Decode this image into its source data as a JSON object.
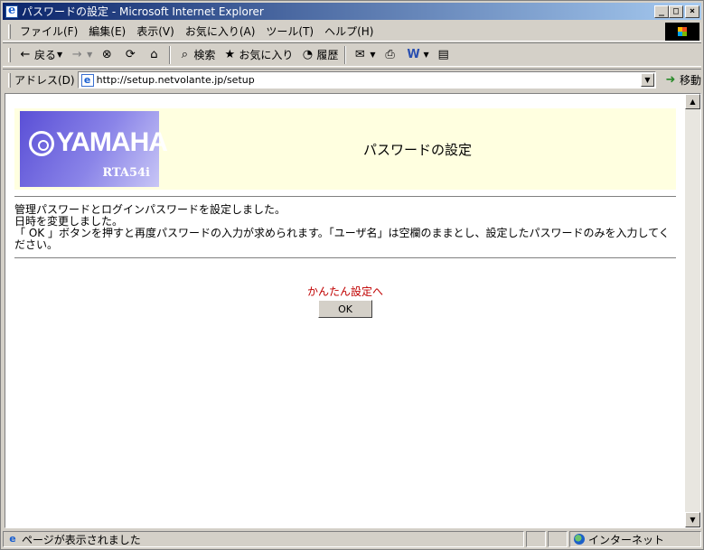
{
  "window": {
    "title": "パスワードの設定 - Microsoft Internet Explorer",
    "minimize": "_",
    "maximize": "□",
    "close": "×"
  },
  "menu": {
    "items": [
      "ファイル(F)",
      "編集(E)",
      "表示(V)",
      "お気に入り(A)",
      "ツール(T)",
      "ヘルプ(H)"
    ]
  },
  "toolbar": {
    "back": "戻る",
    "search": "検索",
    "favorites": "お気に入り",
    "history": "履歴",
    "icons": {
      "back": "←",
      "forward": "→",
      "stop": "⊗",
      "refresh": "⟳",
      "home": "⌂",
      "search": "⌕",
      "favorites": "★",
      "history": "◔",
      "mail": "✉",
      "print": "⎙",
      "edit": "W",
      "discuss": "▤"
    }
  },
  "address": {
    "label": "アドレス(D)",
    "url": "http://setup.netvolante.jp/setup",
    "go": "移動"
  },
  "page": {
    "brand": "YAMAHA",
    "model": "RTA54i",
    "title": "パスワードの設定",
    "messages": [
      "管理パスワードとログインパスワードを設定しました。",
      "日時を変更しました。",
      "「 OK 」ボタンを押すと再度パスワードの入力が求められます。「ユーザ名」は空欄のままとし、設定したパスワードのみを入力してください。"
    ],
    "link": "かんたん設定へ",
    "ok_button": "OK"
  },
  "status": {
    "text": "ページが表示されました",
    "zone": "インターネット"
  }
}
